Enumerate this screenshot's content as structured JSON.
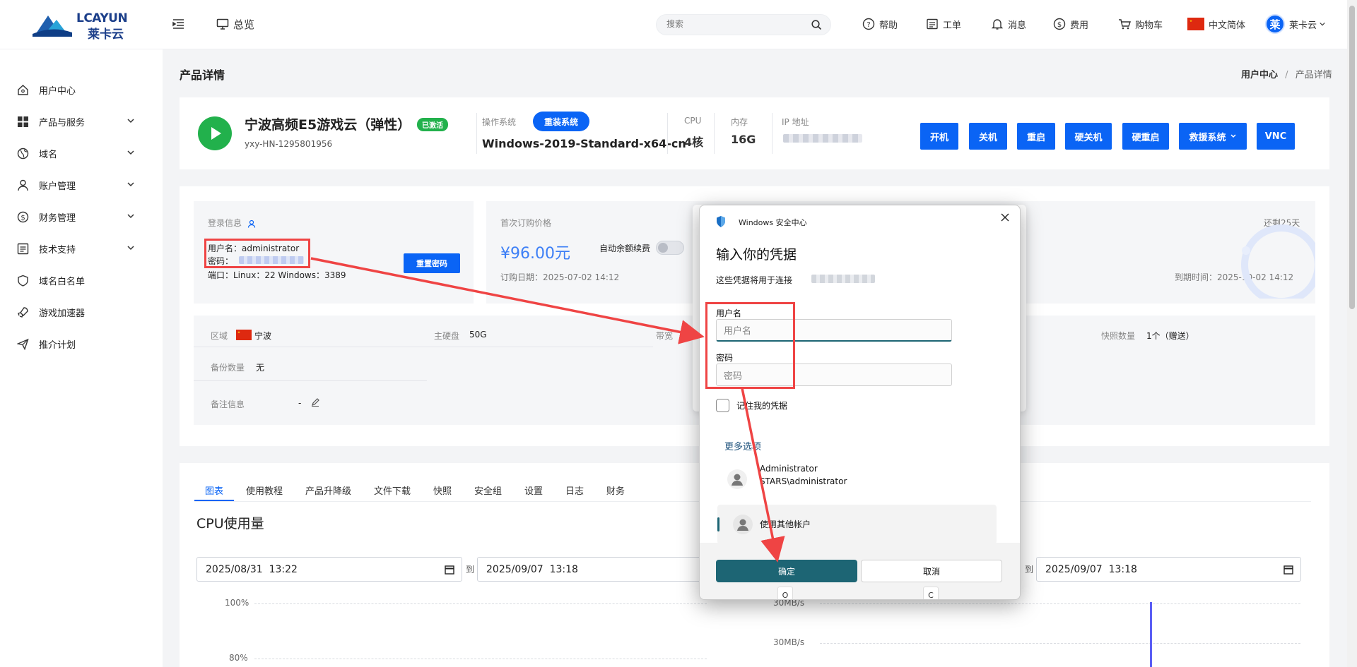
{
  "header": {
    "logo_text": "LCAYUN",
    "logo_cn": "莱卡云",
    "overview": "总览",
    "search_placeholder": "搜索",
    "help": "帮助",
    "ticket": "工单",
    "message": "消息",
    "fees": "费用",
    "cart": "购物车",
    "language": "中文简体",
    "avatar_char": "莱",
    "user": "莱卡云"
  },
  "sidebar": {
    "items": [
      {
        "label": "用户中心"
      },
      {
        "label": "产品与服务"
      },
      {
        "label": "域名"
      },
      {
        "label": "账户管理"
      },
      {
        "label": "财务管理"
      },
      {
        "label": "技术支持"
      },
      {
        "label": "域名白名单"
      },
      {
        "label": "游戏加速器"
      },
      {
        "label": "推介计划"
      }
    ]
  },
  "page": {
    "title": "产品详情",
    "breadcrumb_home": "用户中心",
    "breadcrumb_sep": "/",
    "breadcrumb_current": "产品详情"
  },
  "product": {
    "name": "宁波高频E5游戏云（弹性）",
    "status": "已激活",
    "id": "yxy-HN-1295801956",
    "os_label": "操作系统",
    "reinstall": "重装系统",
    "os": "Windows-2019-Standard-x64-cn",
    "cpu_label": "CPU",
    "cpu": "4核",
    "mem_label": "内存",
    "mem": "16G",
    "ip_label": "IP 地址",
    "actions": [
      "开机",
      "关机",
      "重启",
      "硬关机",
      "硬重启",
      "救援系统",
      "VNC"
    ]
  },
  "login": {
    "title": "登录信息",
    "user_line": "用户名：administrator",
    "pwd_label": "密码：",
    "port_line": "端口：Linux：22 Windows：3389",
    "reset": "重置密码"
  },
  "order": {
    "first_label": "首次订购价格",
    "price": "¥96.00元",
    "auto_renew": "自动余额续费",
    "order_date": "订购日期：2025-07-02 14:12",
    "remain": "还剩25天",
    "expire": "到期时间：2025-10-02 14:12"
  },
  "info": {
    "region_label": "区域",
    "region": "宁波",
    "disk_label": "主硬盘",
    "disk": "50G",
    "bw_label": "带宽",
    "snap_label": "快照数量",
    "snap": "1个（赠送）",
    "backup_label": "备份数量",
    "backup": "无",
    "note_label": "备注信息",
    "note": "-"
  },
  "tabs": [
    "图表",
    "使用教程",
    "产品升降级",
    "文件下载",
    "快照",
    "安全组",
    "设置",
    "日志",
    "财务"
  ],
  "chart": {
    "title": "CPU使用量",
    "date_from": "2025/08/31  13:22",
    "date_to": "2025/09/07  13:18",
    "to_label": "到",
    "date_to_right": "2025/09/07  13:18",
    "y_top": "100%",
    "y_second": "80%",
    "net_top": "30MB/s",
    "net_mid": "30MB/s"
  },
  "dialog": {
    "app": "Windows 安全中心",
    "heading": "输入你的凭据",
    "subtitle": "这些凭据将用于连接",
    "user_label": "用户名",
    "user_placeholder": "用户名",
    "pwd_label": "密码",
    "pwd_placeholder": "密码",
    "remember": "记住我的凭据",
    "more": "更多选项",
    "account_name": "Administrator",
    "account_domain": "STARS\\administrator",
    "other": "使用其他帐户",
    "ok": "确定",
    "cancel": "取消",
    "key_ok": "O",
    "key_cancel": "C"
  },
  "colors": {
    "primary": "#0a64f5",
    "green": "#22b14c",
    "win_teal": "#1d6574",
    "annotation_red": "#ef4444"
  }
}
